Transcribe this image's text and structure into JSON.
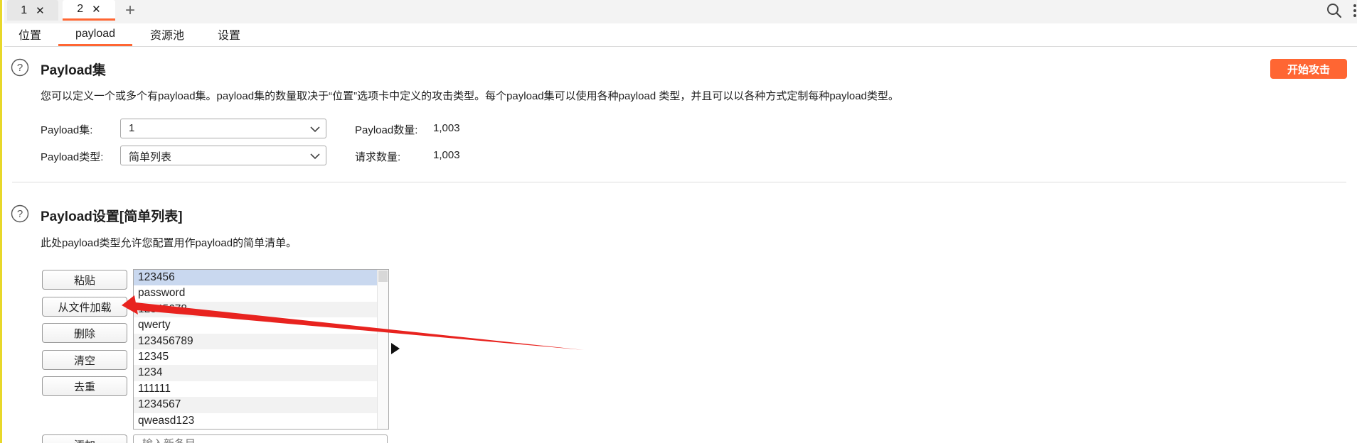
{
  "window_tabs": [
    {
      "label": "1",
      "close": "✕"
    },
    {
      "label": "2",
      "close": "✕"
    }
  ],
  "new_tab_label": "+",
  "sub_tabs": [
    "位置",
    "payload",
    "资源池",
    "设置"
  ],
  "active_sub_tab": "payload",
  "payload_sets": {
    "title": "Payload集",
    "description": "您可以定义一个或多个有payload集。payload集的数量取决于“位置”选项卡中定义的攻击类型。每个payload集可以使用各种payload 类型，并且可以以各种方式定制每种payload类型。",
    "start_attack_label": "开始攻击",
    "set_label": "Payload集:",
    "set_value": "1",
    "type_label": "Payload类型:",
    "type_value": "简单列表",
    "count_label": "Payload数量:",
    "count_value": "1,003",
    "request_label": "请求数量:",
    "request_value": "1,003"
  },
  "payload_settings": {
    "title": "Payload设置[简单列表]",
    "description": "此处payload类型允许您配置用作payload的简单清单。",
    "buttons": {
      "paste": "粘贴",
      "load_file": "从文件加载",
      "remove": "删除",
      "clear": "清空",
      "dedupe": "去重",
      "add": "添加"
    },
    "items": [
      "123456",
      "password",
      "12345678",
      "qwerty",
      "123456789",
      "12345",
      "1234",
      "111111",
      "1234567",
      "qweasd123"
    ],
    "selected_item": "123456",
    "add_placeholder": "输入新条目"
  },
  "colors": {
    "accent": "#ff6633",
    "annotation_arrow": "#e8231f",
    "selection": "#c9d8ef",
    "left_border": "#e8d82a"
  }
}
